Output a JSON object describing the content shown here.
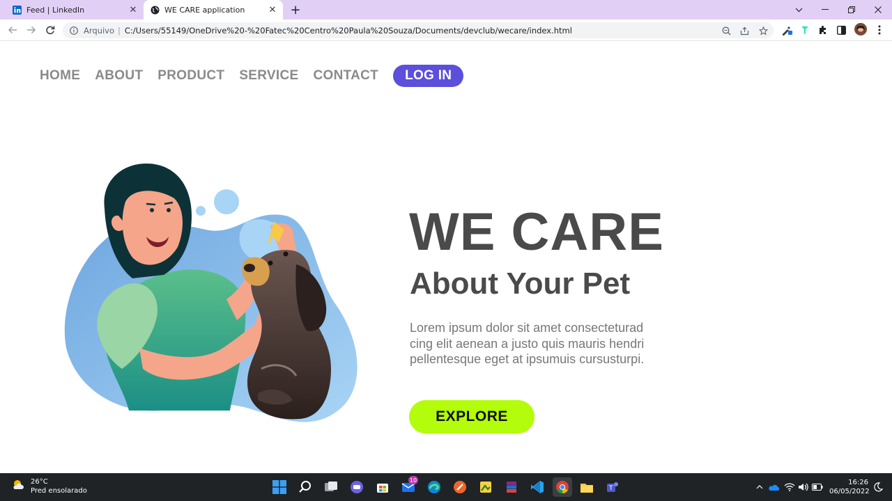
{
  "browser": {
    "tabs": [
      {
        "title": "Feed | LinkedIn",
        "favicon": "linkedin-icon",
        "active": false
      },
      {
        "title": "WE CARE application",
        "favicon": "globe-icon",
        "active": true
      }
    ],
    "address": {
      "scheme_label": "Arquivo",
      "url": "C:/Users/55149/OneDrive%20-%20Fatec%20Centro%20Paula%20Souza/Documents/devclub/wecare/index.html"
    }
  },
  "site": {
    "nav": {
      "items": [
        "HOME",
        "ABOUT",
        "PRODUCT",
        "SERVICE",
        "CONTACT"
      ],
      "login_label": "LOG IN"
    },
    "hero": {
      "title": "WE CARE",
      "subtitle": "About Your Pet",
      "text": "Lorem ipsum dolor sit amet consectetur ad cing elit aenean a justo quis mauris hendri pellentesque eget at ipsumuis cursusturpi.",
      "text_lines": [
        "Lorem ipsum dolor sit amet consecteturad",
        "cing elit aenean a justo quis mauris hendri",
        "pellentesque eget at ipsumuis cursusturpi."
      ],
      "explore_label": "EXPLORE"
    },
    "colors": {
      "login_bg": "#5b4fdc",
      "explore_bg": "#b3fc0b",
      "heading": "#4a4a4a",
      "nav_text": "#8a8a8a"
    }
  },
  "taskbar": {
    "weather": {
      "temp": "26°C",
      "desc": "Pred ensolarado"
    },
    "mail_badge": "10",
    "clock": {
      "time": "16:26",
      "date": "06/05/2022"
    }
  }
}
